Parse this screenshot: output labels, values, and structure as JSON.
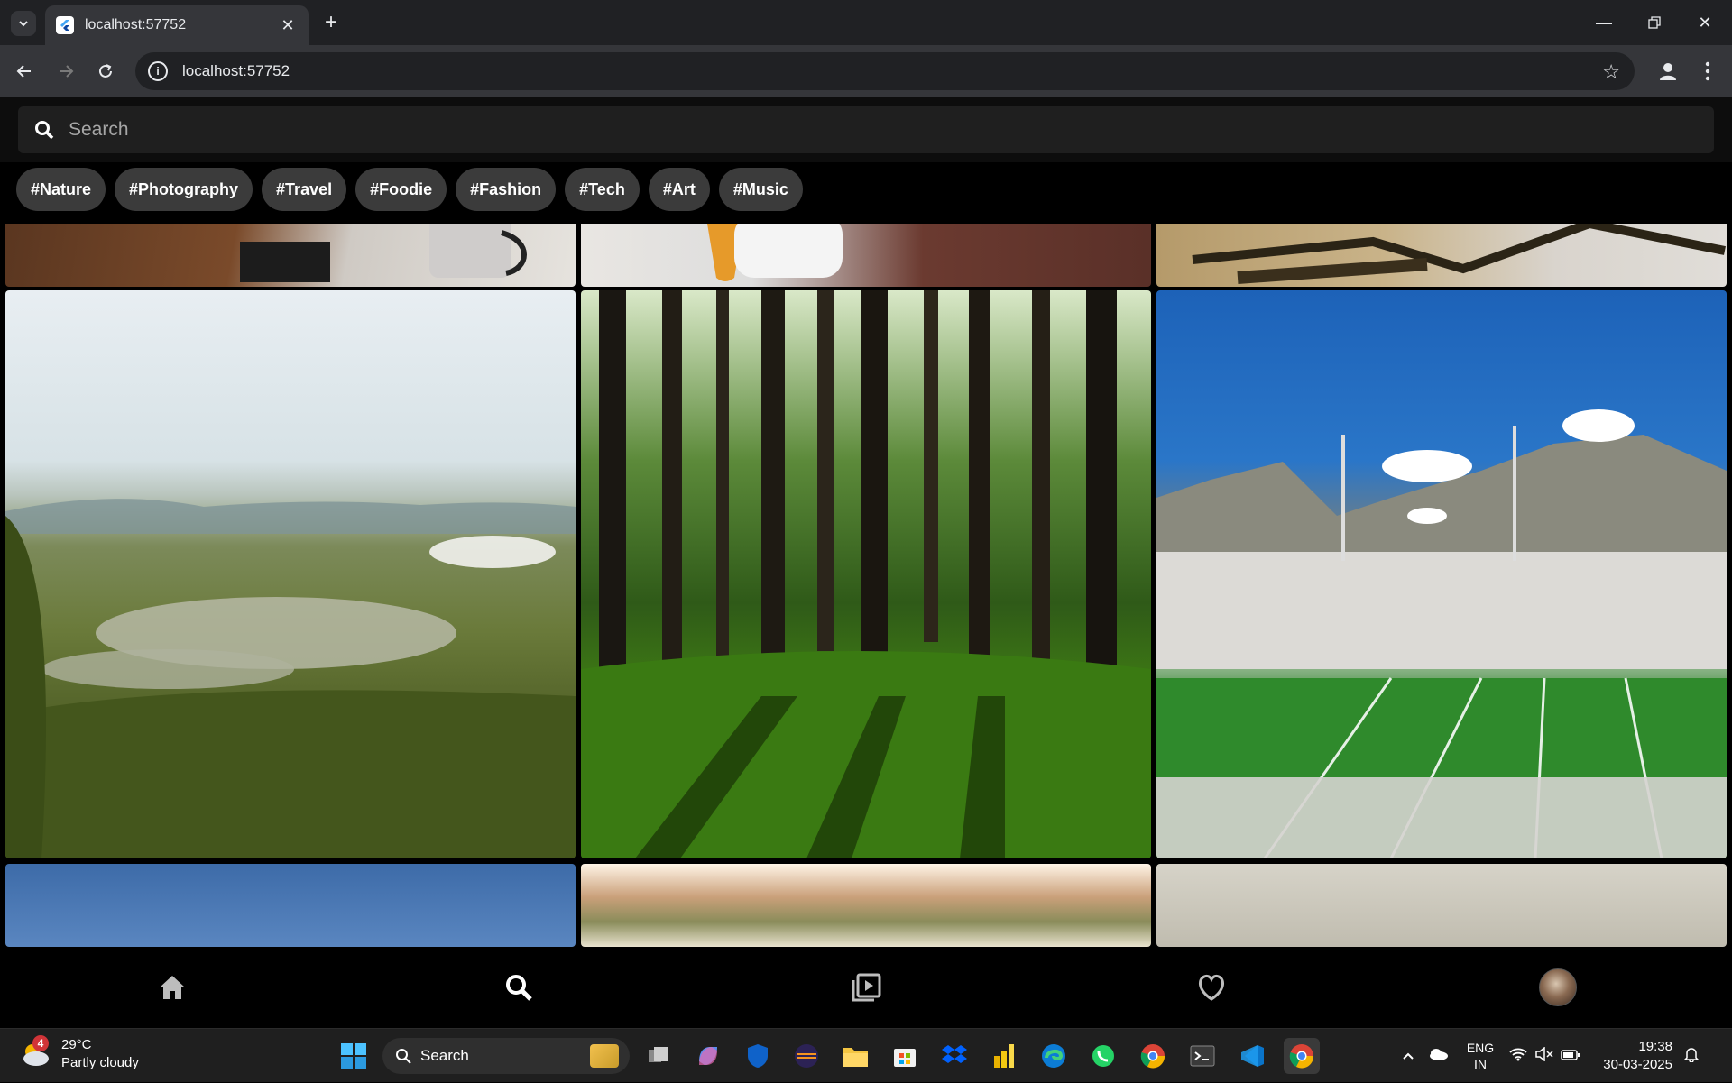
{
  "browser": {
    "tab_title": "localhost:57752",
    "url": "localhost:57752"
  },
  "app": {
    "search_placeholder": "Search",
    "chips": [
      "#Nature",
      "#Photography",
      "#Travel",
      "#Foodie",
      "#Fashion",
      "#Tech",
      "#Art",
      "#Music"
    ],
    "bottom_nav": [
      "home-icon",
      "search-icon",
      "video-library-icon",
      "heart-icon",
      "profile-avatar"
    ]
  },
  "taskbar": {
    "weather_temp": "29°C",
    "weather_desc": "Partly cloudy",
    "weather_badge": "4",
    "search_label": "Search",
    "lang_1": "ENG",
    "lang_2": "IN",
    "time": "19:38",
    "date": "30-03-2025"
  },
  "colors": {
    "accent_chip": "#3b3b3b",
    "chrome_bg": "#202124",
    "toolbar_bg": "#35363a"
  }
}
